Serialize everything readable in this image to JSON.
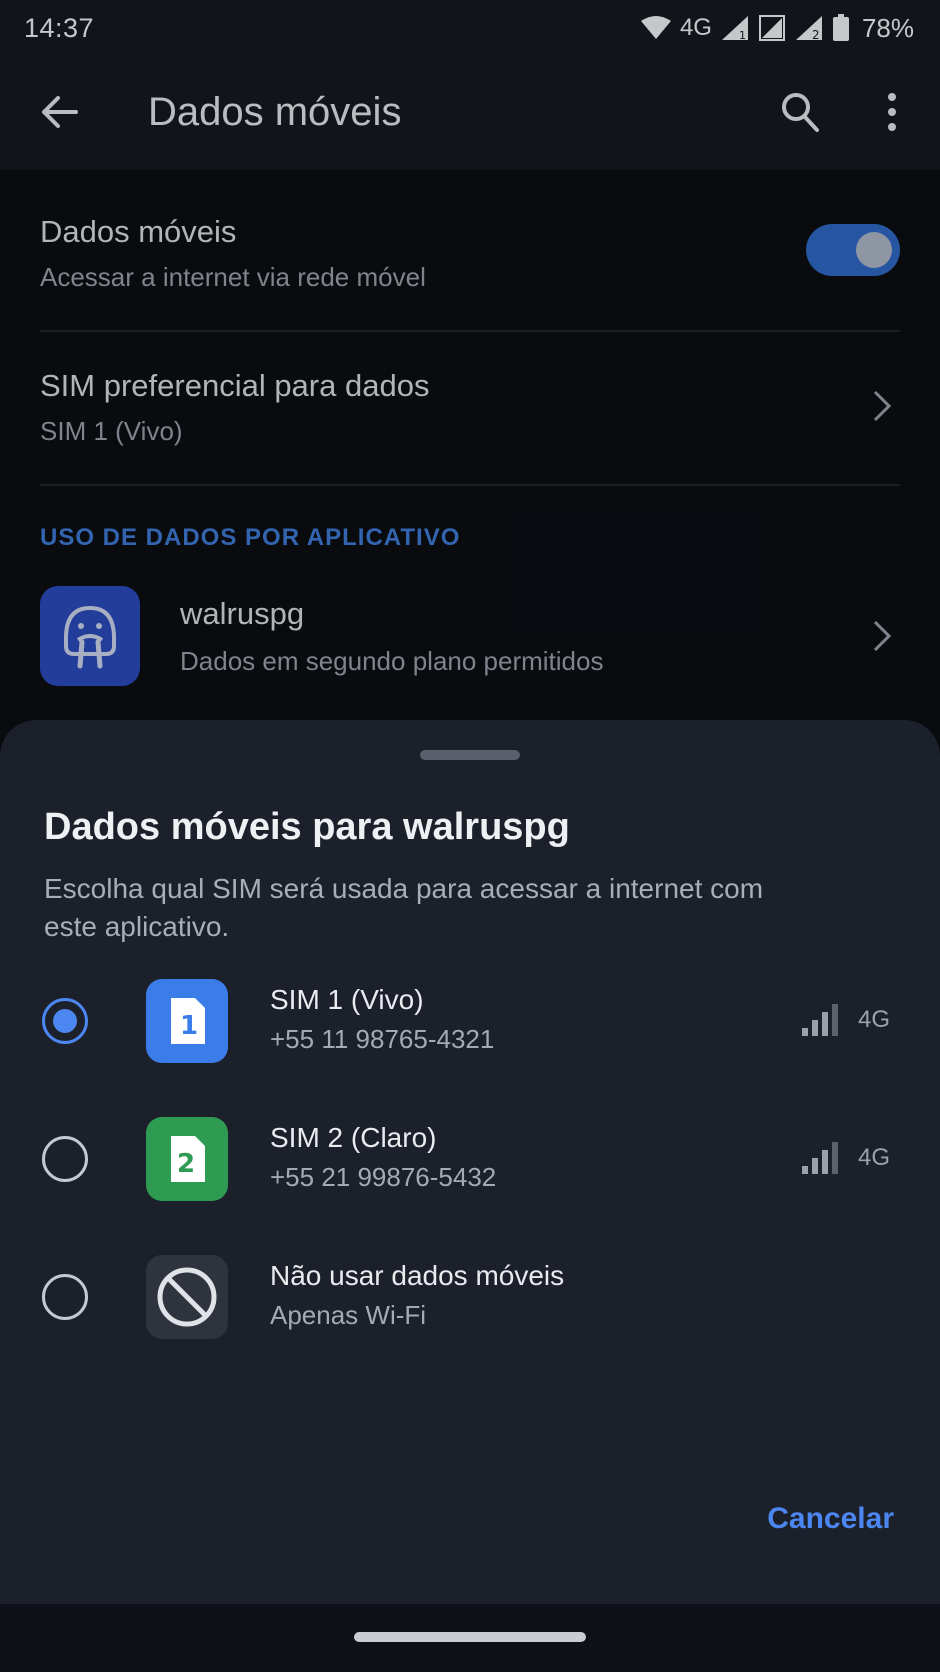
{
  "status_bar": {
    "time": "14:37",
    "network_type": "4G",
    "sim1_badge": "1",
    "sim2_badge": "2",
    "battery": "78%",
    "icons": [
      "wifi-icon",
      "signal-sim1-icon",
      "signal-sim2-icon",
      "battery-icon"
    ]
  },
  "app_bar": {
    "title": "Dados móveis",
    "icons": [
      "back-arrow-icon",
      "search-icon",
      "more-vert-icon"
    ]
  },
  "settings": {
    "mobile_data": {
      "title": "Dados móveis",
      "subtitle": "Acessar a internet via rede móvel",
      "enabled": true
    },
    "preferred_sim": {
      "title": "SIM preferencial para dados",
      "subtitle": "SIM 1 (Vivo)"
    },
    "section_header": "USO DE DADOS POR APLICATIVO",
    "app": {
      "name": "walruspg",
      "subtitle": "Dados em segundo plano permitidos",
      "icon": "walrus-icon"
    }
  },
  "sheet": {
    "title": "Dados móveis para walruspg",
    "description": "Escolha qual SIM será usada para acessar a internet com este aplicativo.",
    "options": [
      {
        "title": "SIM 1 (Vivo)",
        "subtitle": "+55 11 98765-4321",
        "badge": "1",
        "tech": "4G",
        "selected": true,
        "color": "#3b7de8"
      },
      {
        "title": "SIM 2 (Claro)",
        "subtitle": "+55 21 99876-5432",
        "badge": "2",
        "tech": "4G",
        "selected": false,
        "color": "#2e9a52"
      },
      {
        "title": "Não usar dados móveis",
        "subtitle": "Apenas Wi-Fi",
        "selected": false,
        "icon": "block-icon"
      }
    ],
    "cancel_label": "Cancelar"
  },
  "colors": {
    "accent": "#4c86f0",
    "toggle_on": "#2f68c6",
    "sheet_bg": "#1b202a"
  }
}
